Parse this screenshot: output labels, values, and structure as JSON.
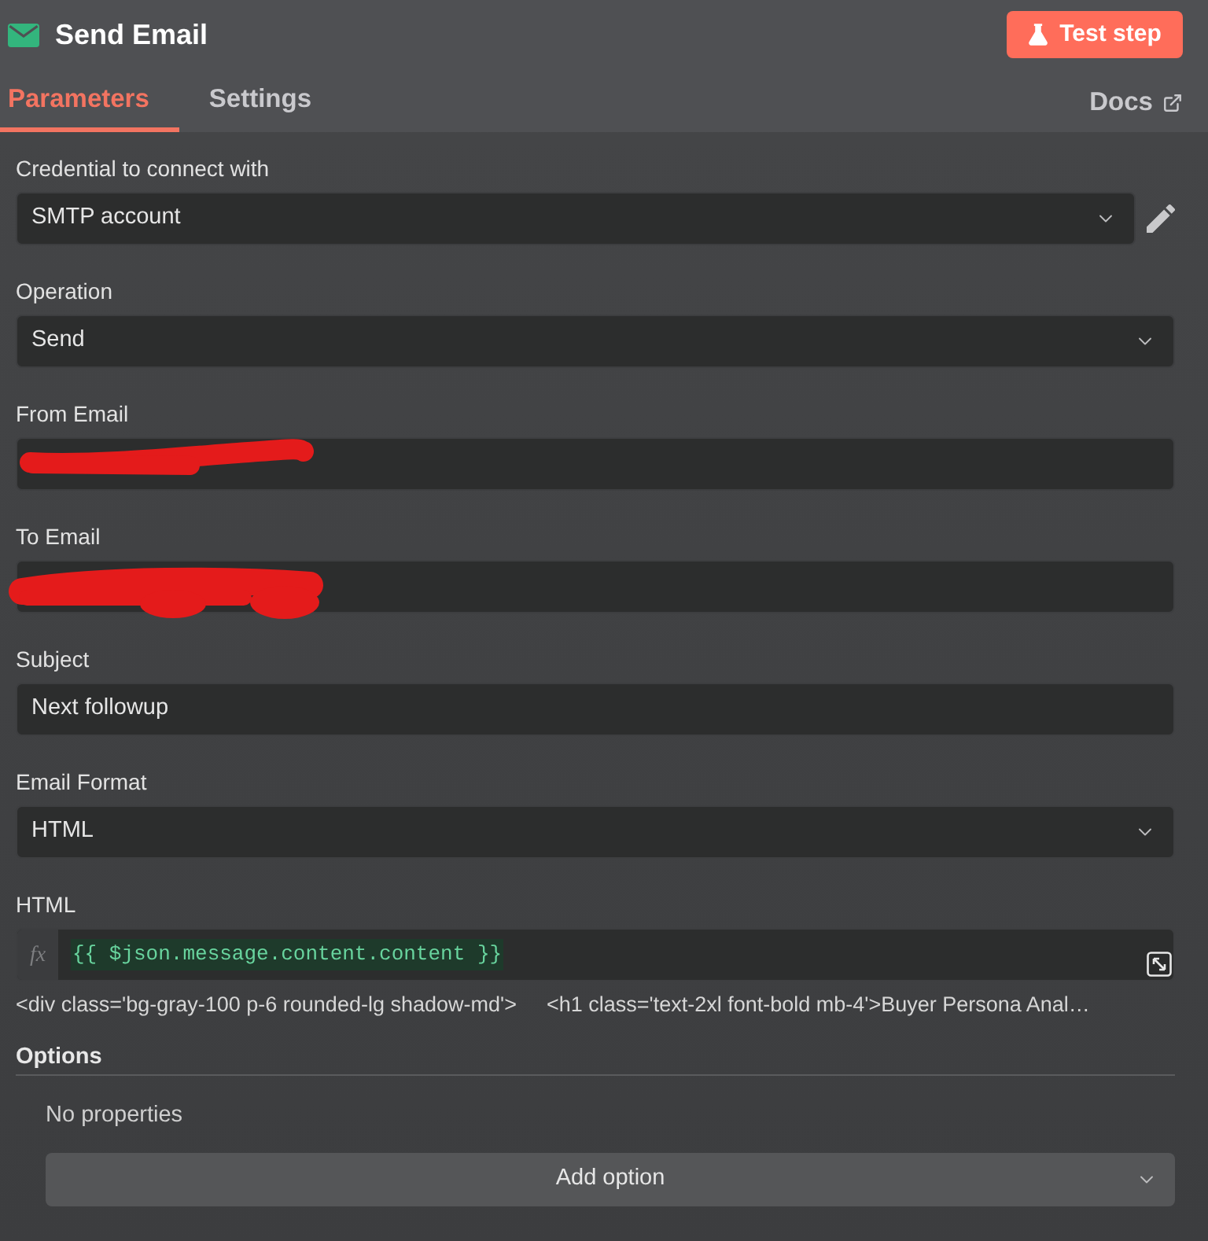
{
  "header": {
    "title": "Send Email",
    "action_button": "Test step"
  },
  "tabs": [
    {
      "label": "Parameters",
      "selected": true
    },
    {
      "label": "Settings",
      "selected": false
    }
  ],
  "docs_link": "Docs",
  "fields": [
    {
      "kind": "select",
      "label": "Credential to connect with",
      "value": "SMTP account",
      "editable": true
    },
    {
      "kind": "select",
      "label": "Operation",
      "value": "Send",
      "editable": false
    },
    {
      "kind": "text",
      "label": "From Email",
      "redacted": true
    },
    {
      "kind": "text",
      "label": "To Email",
      "redacted": true
    },
    {
      "kind": "text",
      "label": "Subject",
      "value": "Next followup",
      "redacted": false
    },
    {
      "kind": "select",
      "label": "Email Format",
      "value": "HTML",
      "editable": false
    },
    {
      "kind": "expression",
      "label": "HTML",
      "prefix": "fx",
      "value": "{{ $json.message.content.content }}",
      "result_preview": [
        "<div class='bg-gray-100 p-6 rounded-lg shadow-md'>",
        "<h1 class='text-2xl font-bold mb-4'>Buyer Persona Anal…"
      ]
    }
  ],
  "options": {
    "title": "Options",
    "empty_text": "No properties",
    "add_button": "Add option"
  }
}
